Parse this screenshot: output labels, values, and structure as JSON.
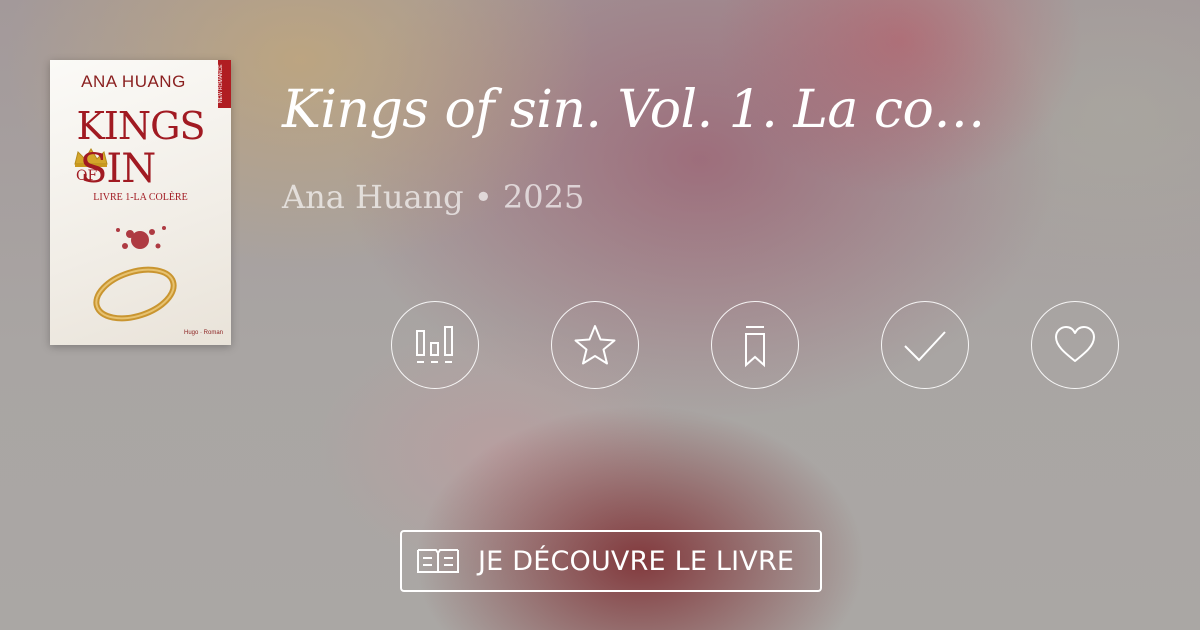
{
  "book": {
    "title": "Kings of sin. Vol. 1. La co…",
    "meta": "Ana Huang • 2025",
    "cover": {
      "author": "ANA HUANG",
      "title_line1": "KINGS",
      "title_of": "OF",
      "title_line2": "SIN",
      "subtitle": "LIVRE 1-LA COLÈRE",
      "publisher": "Hugo · Roman",
      "ribbon": "NEW ROMANCE",
      "colors": {
        "title": "#a11a22"
      }
    }
  },
  "actions": [
    {
      "name": "stats-icon"
    },
    {
      "name": "star-icon"
    },
    {
      "name": "bookmark-icon"
    },
    {
      "name": "check-icon"
    },
    {
      "name": "heart-icon"
    }
  ],
  "cta": {
    "label": "JE DÉCOUVRE LE LIVRE",
    "icon": "open-book-icon"
  },
  "colors": {
    "accent": "#ffffff",
    "background": "#a9a6a3"
  }
}
